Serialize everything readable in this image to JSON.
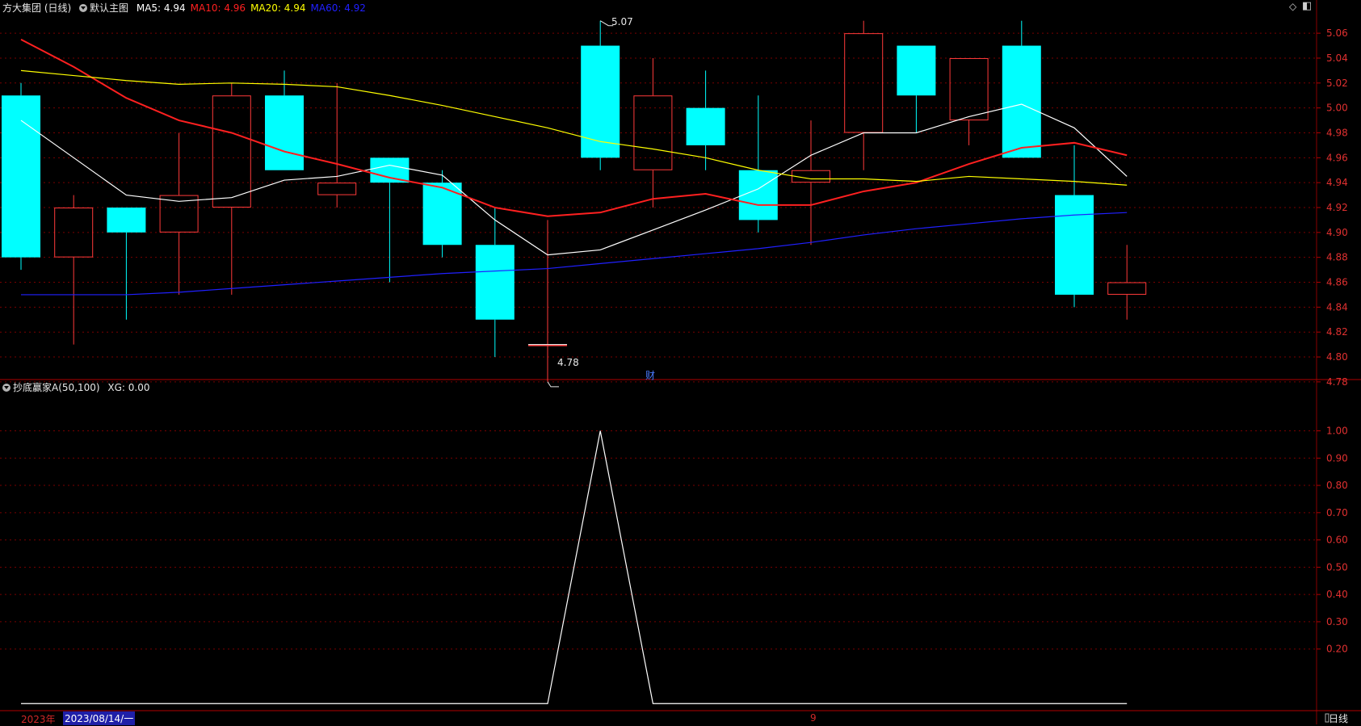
{
  "header": {
    "stock_title": "方大集团 (日线)",
    "main_chart_label": "默认主图",
    "indicators": [
      {
        "label": "MA5:",
        "value": "4.94",
        "color": "#ffffff"
      },
      {
        "label": "MA10:",
        "value": "4.96",
        "color": "#ff2020"
      },
      {
        "label": "MA20:",
        "value": "4.94",
        "color": "#ffff00"
      },
      {
        "label": "MA60:",
        "value": "4.92",
        "color": "#2020ff"
      }
    ]
  },
  "sub_header": {
    "indicator_name": "抄底赢家A(50,100)",
    "xg_label": "XG:",
    "xg_value": "0.00"
  },
  "annotations": {
    "high_label": "5.07",
    "low_label": "4.78",
    "finance_marker": "财"
  },
  "bottom_bar": {
    "year": "2023年",
    "selected_date": "2023/08/14/一",
    "month_marker": "9",
    "period": "日线"
  },
  "colors": {
    "up": "#ff3a3a",
    "down": "#00ffff",
    "grid": "#7a0000",
    "axis_text": "#e03030"
  },
  "chart_data": [
    {
      "type": "candlestick",
      "y_axis_ticks": [
        "4.78",
        "4.80",
        "4.82",
        "4.84",
        "4.86",
        "4.88",
        "4.90",
        "4.92",
        "4.94",
        "4.96",
        "4.98",
        "5.00",
        "5.02",
        "5.04",
        "5.06"
      ],
      "ylim": [
        4.765,
        5.075
      ],
      "candles": [
        {
          "o": 5.01,
          "h": 5.02,
          "l": 4.87,
          "c": 4.88
        },
        {
          "o": 4.88,
          "h": 4.93,
          "l": 4.81,
          "c": 4.92
        },
        {
          "o": 4.92,
          "h": 4.92,
          "l": 4.83,
          "c": 4.9
        },
        {
          "o": 4.9,
          "h": 4.98,
          "l": 4.85,
          "c": 4.93
        },
        {
          "o": 4.92,
          "h": 5.02,
          "l": 4.85,
          "c": 5.01
        },
        {
          "o": 5.01,
          "h": 5.03,
          "l": 4.95,
          "c": 4.95
        },
        {
          "o": 4.93,
          "h": 5.02,
          "l": 4.92,
          "c": 4.94
        },
        {
          "o": 4.96,
          "h": 4.96,
          "l": 4.86,
          "c": 4.94
        },
        {
          "o": 4.94,
          "h": 4.95,
          "l": 4.88,
          "c": 4.89
        },
        {
          "o": 4.89,
          "h": 4.92,
          "l": 4.8,
          "c": 4.83
        },
        {
          "o": 4.81,
          "h": 4.91,
          "l": 4.78,
          "c": 4.81
        },
        {
          "o": 5.05,
          "h": 5.07,
          "l": 4.95,
          "c": 4.96
        },
        {
          "o": 4.95,
          "h": 5.04,
          "l": 4.92,
          "c": 5.01
        },
        {
          "o": 5.0,
          "h": 5.03,
          "l": 4.95,
          "c": 4.97
        },
        {
          "o": 4.95,
          "h": 5.01,
          "l": 4.9,
          "c": 4.91
        },
        {
          "o": 4.94,
          "h": 4.99,
          "l": 4.89,
          "c": 4.95
        },
        {
          "o": 4.98,
          "h": 5.07,
          "l": 4.95,
          "c": 5.06
        },
        {
          "o": 5.05,
          "h": 5.05,
          "l": 4.98,
          "c": 5.01
        },
        {
          "o": 4.99,
          "h": 5.04,
          "l": 4.97,
          "c": 5.04
        },
        {
          "o": 5.05,
          "h": 5.07,
          "l": 4.96,
          "c": 4.96
        },
        {
          "o": 4.93,
          "h": 4.97,
          "l": 4.84,
          "c": 4.85
        },
        {
          "o": 4.85,
          "h": 4.89,
          "l": 4.83,
          "c": 4.86
        }
      ],
      "series": [
        {
          "name": "MA5",
          "color": "#ffffff",
          "values": [
            4.99,
            4.96,
            4.93,
            4.925,
            4.928,
            4.942,
            4.945,
            4.954,
            4.946,
            4.91,
            4.882,
            4.886,
            4.902,
            4.918,
            4.935,
            4.962,
            4.98,
            4.98,
            4.993,
            5.003,
            4.984,
            4.945
          ]
        },
        {
          "name": "MA10",
          "color": "#ff2020",
          "values": [
            5.055,
            5.033,
            5.008,
            4.99,
            4.98,
            4.965,
            4.955,
            4.944,
            4.936,
            4.92,
            4.913,
            4.916,
            4.927,
            4.931,
            4.922,
            4.922,
            4.933,
            4.94,
            4.955,
            4.968,
            4.972,
            4.962
          ]
        },
        {
          "name": "MA20",
          "color": "#ffff00",
          "values": [
            5.03,
            5.026,
            5.022,
            5.019,
            5.02,
            5.019,
            5.017,
            5.01,
            5.002,
            4.993,
            4.984,
            4.973,
            4.967,
            4.96,
            4.95,
            4.943,
            4.943,
            4.941,
            4.945,
            4.943,
            4.941,
            4.938
          ]
        },
        {
          "name": "MA60",
          "color": "#2020ff",
          "values": [
            4.85,
            4.85,
            4.85,
            4.852,
            4.855,
            4.858,
            4.861,
            4.864,
            4.867,
            4.869,
            4.871,
            4.875,
            4.879,
            4.883,
            4.887,
            4.892,
            4.898,
            4.903,
            4.907,
            4.911,
            4.914,
            4.916
          ]
        }
      ]
    },
    {
      "type": "line",
      "y_axis_ticks": [
        "0.20",
        "0.30",
        "0.40",
        "0.50",
        "0.60",
        "0.70",
        "0.80",
        "0.90",
        "1.00"
      ],
      "ylim": [
        -0.02,
        1.04
      ],
      "series": [
        {
          "name": "XG",
          "color": "#ffffff",
          "values": [
            0,
            0,
            0,
            0,
            0,
            0,
            0,
            0,
            0,
            0,
            0,
            1,
            0,
            0,
            0,
            0,
            0,
            0,
            0,
            0,
            0,
            0
          ]
        }
      ]
    }
  ]
}
